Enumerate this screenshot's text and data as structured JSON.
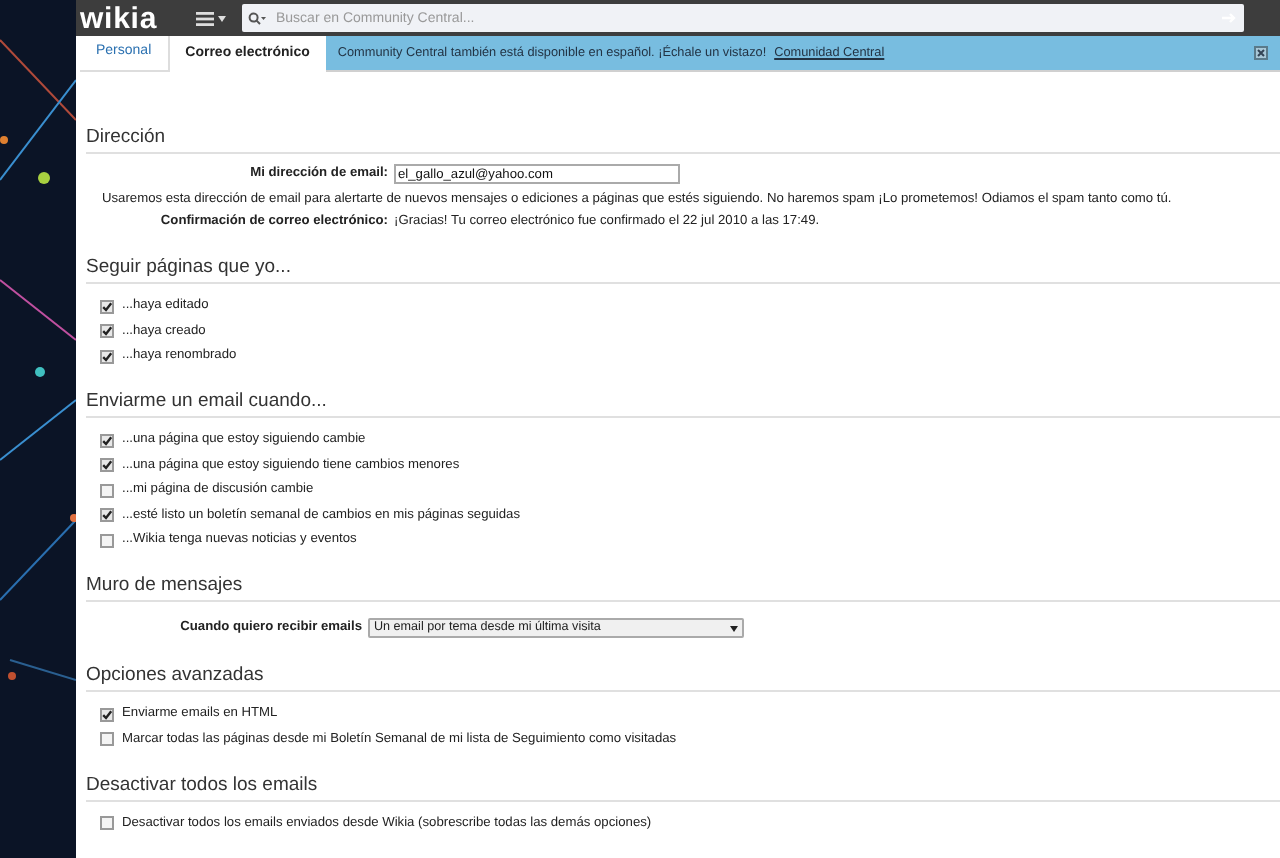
{
  "top_bar": {
    "logo": "wikia",
    "search": {
      "placeholder": "Buscar en Community Central..."
    }
  },
  "tabs": [
    {
      "label": "Personal",
      "selected": false
    },
    {
      "label": "Correo electrónico",
      "selected": true
    }
  ],
  "banner": {
    "text": "Community Central también está disponible en español. ¡Échale un vistazo!",
    "link": "Comunidad Central"
  },
  "sections": [
    {
      "title": "Dirección",
      "rows": [
        {
          "kind": "field",
          "label": "Mi dirección de email:",
          "value": "el_gallo_azul@yahoo.com"
        },
        {
          "kind": "note",
          "text": "Usaremos esta dirección de email para alertarte de nuevos mensajes o ediciones a páginas que estés siguiendo. No haremos spam ¡Lo prometemos! Odiamos el spam tanto como tú."
        },
        {
          "kind": "info",
          "label": "Confirmación de correo electrónico:",
          "text": "¡Gracias! Tu correo electrónico fue confirmado el 22 jul 2010 a las 17:49."
        }
      ]
    },
    {
      "title": "Seguir páginas que yo...",
      "rows": [
        {
          "kind": "checkbox",
          "label": "...haya editado",
          "checked": true
        },
        {
          "kind": "checkbox",
          "label": "...haya creado",
          "checked": true
        },
        {
          "kind": "checkbox",
          "label": "...haya renombrado",
          "checked": true
        }
      ]
    },
    {
      "title": "Enviarme un email cuando...",
      "rows": [
        {
          "kind": "checkbox",
          "label": "...una página que estoy siguiendo cambie",
          "checked": true
        },
        {
          "kind": "checkbox",
          "label": "...una página que estoy siguiendo tiene cambios menores",
          "checked": true
        },
        {
          "kind": "checkbox",
          "label": "...mi página de discusión cambie",
          "checked": false
        },
        {
          "kind": "checkbox",
          "label": "...esté listo un boletín semanal de cambios en mis páginas seguidas",
          "checked": true
        },
        {
          "kind": "checkbox",
          "label": "...Wikia tenga nuevas noticias y eventos",
          "checked": false
        }
      ]
    },
    {
      "title": "Muro de mensajes",
      "rows": [
        {
          "kind": "select",
          "label": "Cuando quiero recibir emails",
          "value": "Un email por tema desde mi última visita"
        }
      ]
    },
    {
      "title": "Opciones avanzadas",
      "rows": [
        {
          "kind": "checkbox",
          "label": "Enviarme emails en HTML",
          "checked": true
        },
        {
          "kind": "checkbox",
          "label": "Marcar todas las páginas desde mi Boletín Semanal de mi lista de Seguimiento como visitadas",
          "checked": false
        }
      ]
    },
    {
      "title": "Desactivar todos los emails",
      "rows": [
        {
          "kind": "checkbox",
          "label": "Desactivar todos los emails enviados desde Wikia (sobrescribe todas las demás opciones)",
          "checked": false
        }
      ]
    }
  ]
}
